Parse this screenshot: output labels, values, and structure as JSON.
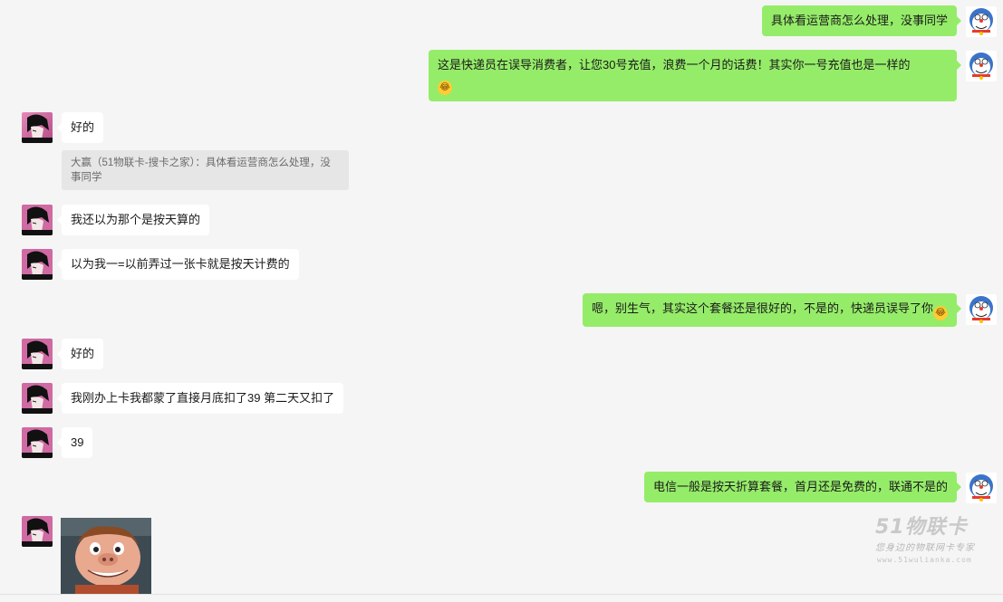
{
  "messages": {
    "m1": "具体看运营商怎么处理，没事同学",
    "m2": "这是快递员在误导消费者，让您30号充值，浪费一个月的话费！其实你一号充值也是一样的",
    "m3": "好的",
    "m3_quote": "大赢（51物联卡-搜卡之家）：具体看运营商怎么处理，没事同学",
    "m4": "我还以为那个是按天算的",
    "m5": "以为我一=以前弄过一张卡就是按天计费的",
    "m6": "嗯，别生气，其实这个套餐还是很好的，不是的，快递员误导了你",
    "m7": "好的",
    "m8": "我刚办上卡我都蒙了直接月底扣了39 第二天又扣了",
    "m9": "39",
    "m10": "电信一般是按天折算套餐，首月还是免费的，联通不是的"
  },
  "emoji": {
    "icon": "laugh-cry-emoji"
  },
  "watermark": {
    "brand": "51物联卡",
    "slogan": "您身边的物联网卡专家",
    "url": "www.51wulianka.com"
  },
  "colors": {
    "background": "#f5f5f5",
    "outgoing_bubble": "#95ec69",
    "incoming_bubble": "#ffffff",
    "quote_bg": "#e6e6e6"
  }
}
